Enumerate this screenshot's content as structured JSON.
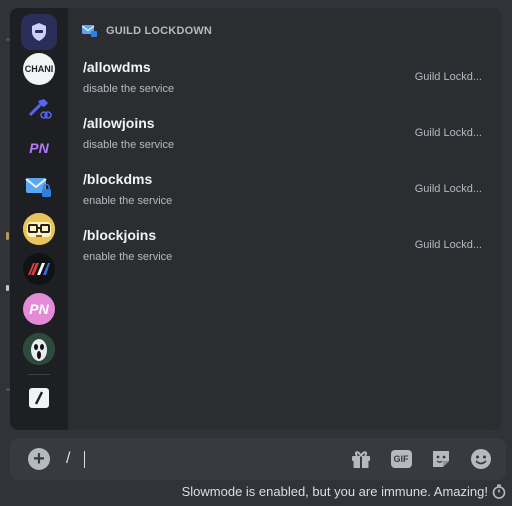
{
  "autocomplete": {
    "section_title": "GUILD LOCKDOWN",
    "commands": [
      {
        "name": "/allowdms",
        "description": "disable the service",
        "source": "Guild Lockd..."
      },
      {
        "name": "/allowjoins",
        "description": "disable the service",
        "source": "Guild Lockd..."
      },
      {
        "name": "/blockdms",
        "description": "enable the service",
        "source": "Guild Lockd..."
      },
      {
        "name": "/blockjoins",
        "description": "enable the service",
        "source": "Guild Lockd..."
      }
    ]
  },
  "rail": {
    "apps": [
      {
        "icon": "shield-app-icon",
        "color": "#2a2f5a"
      },
      {
        "icon": "chani-app-icon",
        "label": "CHANI",
        "color": "#f2f3f5"
      },
      {
        "icon": "hammer-app-icon",
        "color": "#1e1f22"
      },
      {
        "icon": "pn-app-icon",
        "label": "PN",
        "color": "#1e1f22"
      },
      {
        "icon": "mail-lock-app-icon",
        "color": "#1e1f22"
      },
      {
        "icon": "glasses-face-app-icon",
        "color": "#e8c35a"
      },
      {
        "icon": "stripes-app-icon",
        "color": "#111214"
      },
      {
        "icon": "pn-pink-app-icon",
        "label": "PN",
        "color": "#e48bd8"
      },
      {
        "icon": "ghostface-app-icon",
        "color": "#3b5a4a"
      },
      {
        "icon": "slash-commands-icon",
        "color": "#2b2d31"
      }
    ]
  },
  "chatbar": {
    "input_value": "/",
    "tools": [
      "gift-icon",
      "gif-icon",
      "sticker-icon",
      "emoji-icon"
    ],
    "gif_label": "GIF"
  },
  "footer": {
    "text": "Slowmode is enabled, but you are immune. Amazing!",
    "icon": "stopwatch-icon"
  }
}
